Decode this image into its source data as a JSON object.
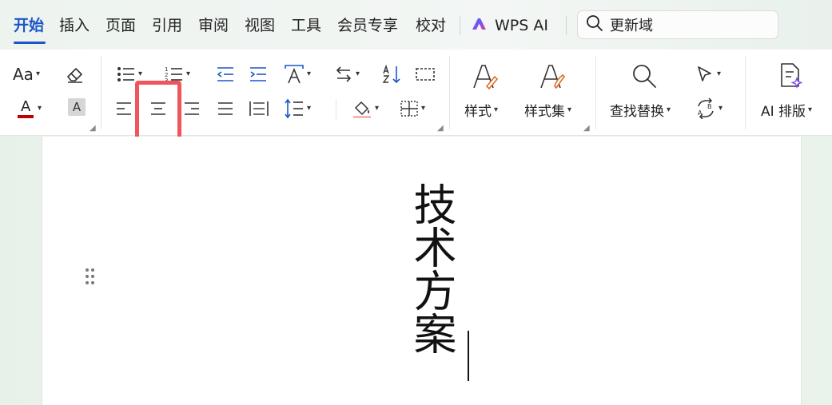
{
  "tabs": [
    {
      "label": "开始",
      "active": true
    },
    {
      "label": "插入"
    },
    {
      "label": "页面"
    },
    {
      "label": "引用"
    },
    {
      "label": "审阅"
    },
    {
      "label": "视图"
    },
    {
      "label": "工具"
    },
    {
      "label": "会员专享"
    },
    {
      "label": "校对"
    }
  ],
  "wps_ai": {
    "label": "WPS AI"
  },
  "search": {
    "label": "更新域"
  },
  "ribbon": {
    "styles_label": "样式",
    "style_set_label": "样式集",
    "find_replace_label": "查找替换",
    "ai_layout_label": "AI 排版",
    "font_label_glyph": "Aa",
    "highlight_glyph": "A",
    "font_color_glyph": "A",
    "font_color": "#c00000",
    "selected_tool": "center-align"
  },
  "document": {
    "title": "技术方案"
  },
  "colors": {
    "accent": "#1a56c8",
    "highlight_box": "#f0555b"
  }
}
